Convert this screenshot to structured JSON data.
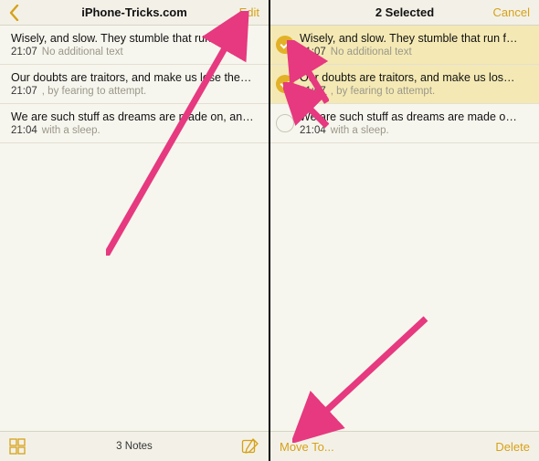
{
  "left": {
    "title": "iPhone-Tricks.com",
    "edit": "Edit",
    "notes": [
      {
        "title": "Wisely, and slow. They stumble that run fast.",
        "time": "21:07",
        "snippet": "No additional text"
      },
      {
        "title": "Our doubts are traitors, and make us lose the…",
        "time": "21:07",
        "snippet": ", by fearing to attempt."
      },
      {
        "title": "We are such stuff as dreams are made on, an…",
        "time": "21:04",
        "snippet": "with a sleep."
      }
    ],
    "footer": "3 Notes"
  },
  "right": {
    "title": "2 Selected",
    "cancel": "Cancel",
    "notes": [
      {
        "title": "Wisely, and slow. They stumble that run f…",
        "time": "21:07",
        "snippet": "No additional text",
        "selected": true
      },
      {
        "title": "Our doubts are traitors, and make us los…",
        "time": "21:07",
        "snippet": ", by fearing to attempt.",
        "selected": true
      },
      {
        "title": "We are such stuff as dreams are made o…",
        "time": "21:04",
        "snippet": "with a sleep.",
        "selected": false
      }
    ],
    "move": "Move To...",
    "delete": "Delete"
  },
  "colors": {
    "accent": "#d7a119",
    "arrow": "#e6397f"
  }
}
